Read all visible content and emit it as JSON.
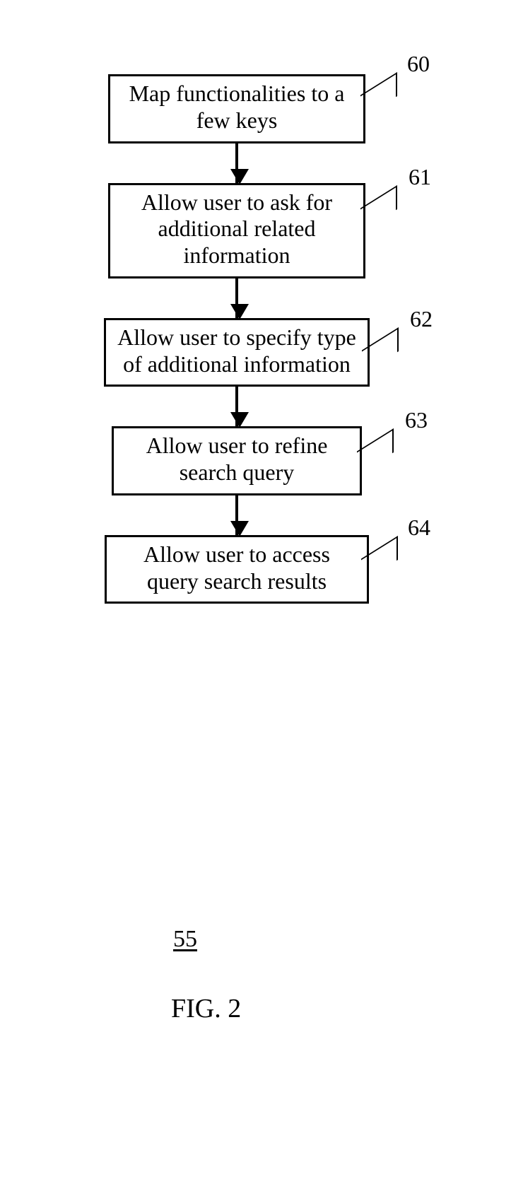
{
  "flow": {
    "steps": [
      {
        "text": "Map functionalities to a few keys",
        "ref": "60"
      },
      {
        "text": "Allow user to ask for additional related information",
        "ref": "61"
      },
      {
        "text": "Allow user to specify type of additional information",
        "ref": "62"
      },
      {
        "text": "Allow user to refine search query",
        "ref": "63"
      },
      {
        "text": "Allow user to access query search results",
        "ref": "64"
      }
    ]
  },
  "figure_number": "55",
  "figure_label": "FIG. 2"
}
